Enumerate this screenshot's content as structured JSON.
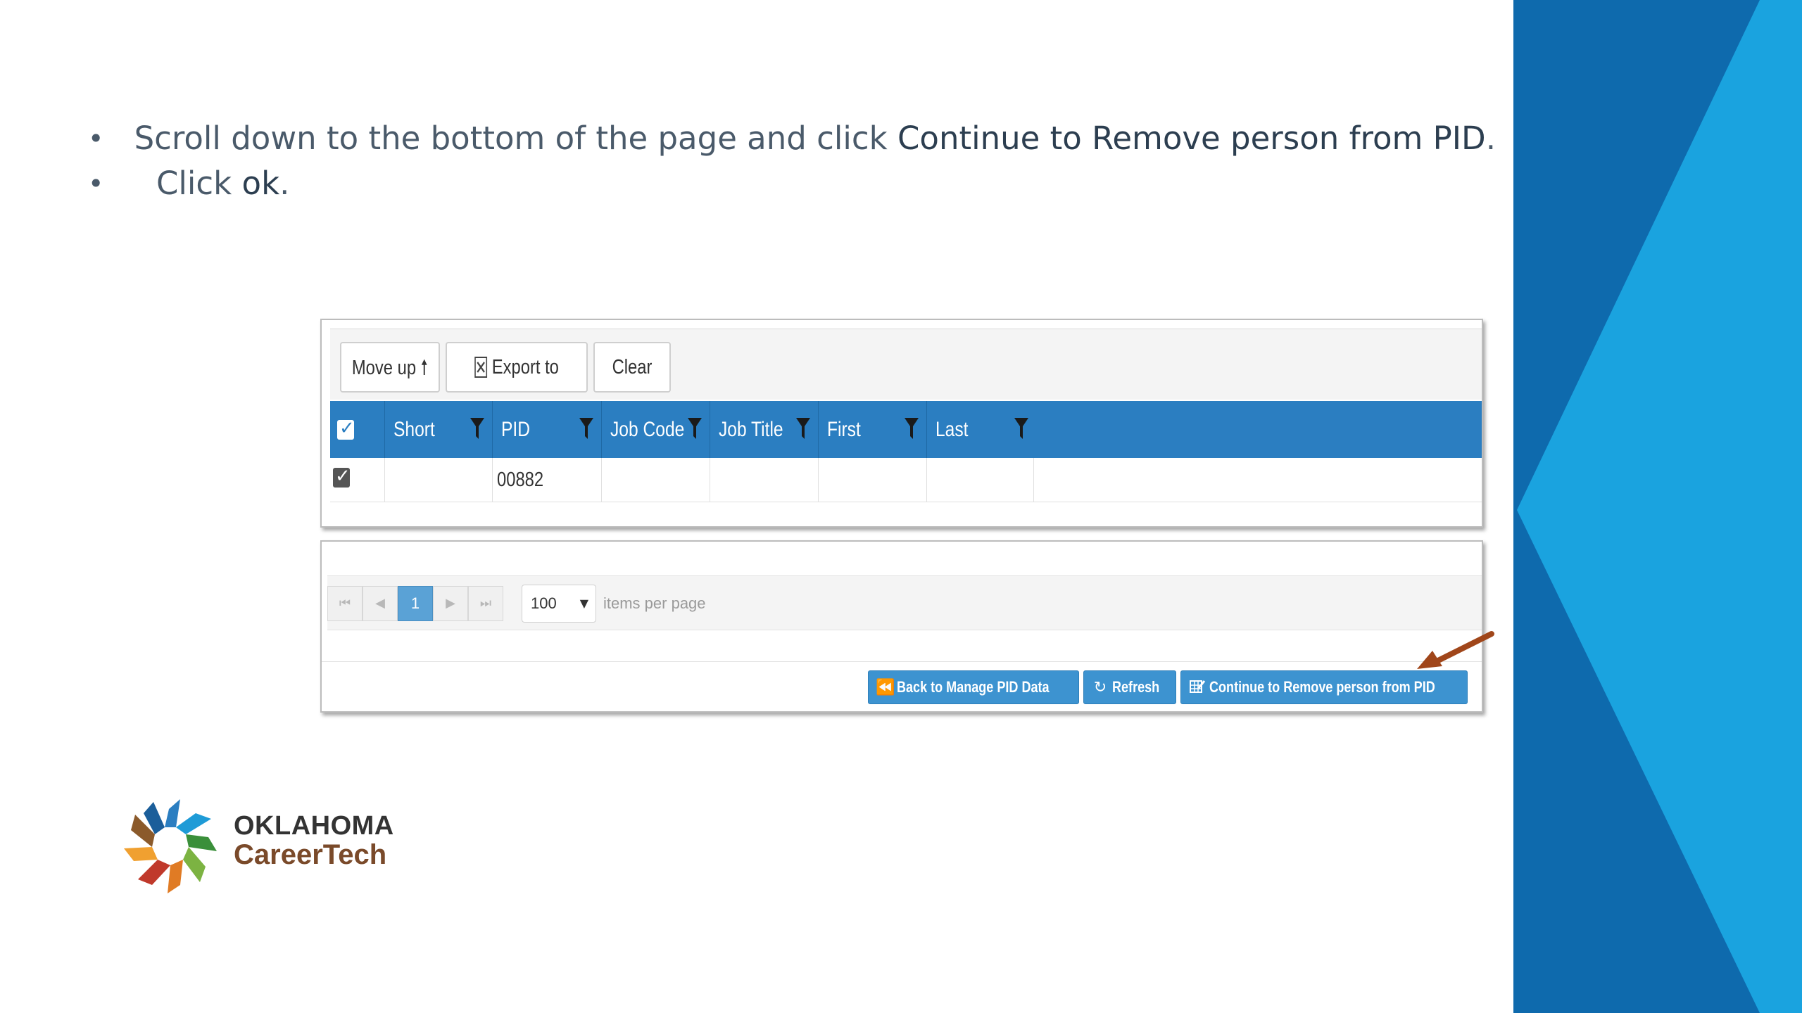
{
  "instructions": [
    {
      "prefix": "Scroll down to the bottom of the page and click ",
      "bold": "Continue to Remove person from PID",
      "suffix": "."
    },
    {
      "prefix": "Click ",
      "bold": "ok",
      "suffix": "."
    }
  ],
  "bullet_glyph": "•",
  "toolbar": {
    "move_up": "Move up",
    "move_up_icon": "arrow-up-icon",
    "export": "Export to Excel",
    "export_icon": "excel-icon",
    "clear_all": "Clear All"
  },
  "grid": {
    "columns": [
      "Short Name",
      "PID",
      "Job Code",
      "Job Title",
      "First Name",
      "Last Name"
    ],
    "rows": [
      {
        "checked": true,
        "short_name": "",
        "pid": "00882",
        "job_code": "",
        "job_title": "",
        "first_name": "",
        "last_name": ""
      }
    ],
    "header_checked": true
  },
  "pager": {
    "first_glyph": "⏮",
    "prev_glyph": "◀",
    "current_page": "1",
    "next_glyph": "▶",
    "last_glyph": "⏭",
    "page_size": "100",
    "page_size_caret": "▼",
    "per_page_label": "items per page"
  },
  "actions": {
    "back": "Back to Manage PID Data",
    "back_icon": "⏪",
    "refresh": "Refresh",
    "refresh_icon": "↻",
    "continue": "Continue to Remove person from PID",
    "continue_icon": "edit-table-icon"
  },
  "logo": {
    "line1": "OKLAHOMA",
    "line2": "CareerTech"
  },
  "colors": {
    "side_dark": "#0e6aad",
    "side_light": "#1aa3df",
    "grid_header": "#2b7ec1",
    "action_button": "#3d93d0",
    "arrow": "#a0461a"
  }
}
